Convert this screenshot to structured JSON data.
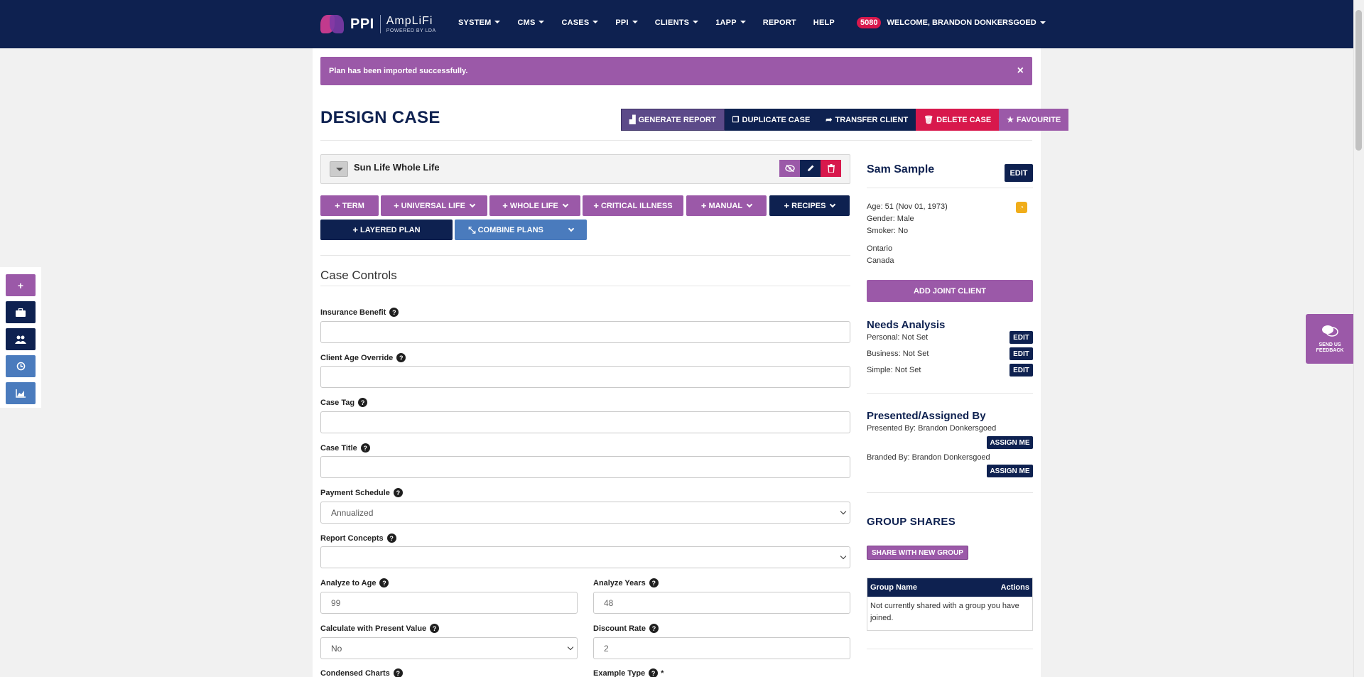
{
  "brand": {
    "ppi": "PPI",
    "amplifi": "AmpLiFi",
    "powered": "POWERED BY LDA"
  },
  "nav": {
    "items": [
      {
        "label": "SYSTEM",
        "dropdown": true
      },
      {
        "label": "CMS",
        "dropdown": true
      },
      {
        "label": "CASES",
        "dropdown": true
      },
      {
        "label": "PPI",
        "dropdown": true
      },
      {
        "label": "CLIENTS",
        "dropdown": true
      },
      {
        "label": "1APP",
        "dropdown": true
      },
      {
        "label": "REPORT",
        "dropdown": false
      },
      {
        "label": "HELP",
        "dropdown": false
      }
    ],
    "notification_count": "5080",
    "welcome": "WELCOME, BRANDON DONKERSGOED"
  },
  "alert": {
    "message": "Plan has been imported successfully.",
    "close": "×"
  },
  "page": {
    "title": "DESIGN CASE",
    "actions": {
      "generate": "GENERATE REPORT",
      "duplicate": "DUPLICATE CASE",
      "transfer": "TRANSFER CLIENT",
      "delete": "DELETE CASE",
      "favourite": "FAVOURITE"
    }
  },
  "plan": {
    "name": "Sun Life Whole Life"
  },
  "add_plan": {
    "term": "TERM",
    "universal_life": "UNIVERSAL LIFE",
    "whole_life": "WHOLE LIFE",
    "critical_illness": "CRITICAL ILLNESS",
    "manual": "MANUAL",
    "recipes": "RECIPES",
    "layered": "LAYERED PLAN",
    "combine": "COMBINE PLANS"
  },
  "case_controls": {
    "title": "Case Controls",
    "insurance_benefit": {
      "label": "Insurance Benefit",
      "value": ""
    },
    "client_age_override": {
      "label": "Client Age Override",
      "value": ""
    },
    "case_tag": {
      "label": "Case Tag",
      "value": ""
    },
    "case_title": {
      "label": "Case Title",
      "value": ""
    },
    "payment_schedule": {
      "label": "Payment Schedule",
      "value": "Annualized"
    },
    "report_concepts": {
      "label": "Report Concepts",
      "value": ""
    },
    "analyze_to_age": {
      "label": "Analyze to Age",
      "value": "99"
    },
    "analyze_years": {
      "label": "Analyze Years",
      "value": "48"
    },
    "present_value": {
      "label": "Calculate with Present Value",
      "value": "No"
    },
    "discount_rate": {
      "label": "Discount Rate",
      "value": "2"
    },
    "condensed_charts": {
      "label": "Condensed Charts"
    },
    "example_type": {
      "label": "Example Type",
      "required": "*"
    }
  },
  "client": {
    "name": "Sam Sample",
    "edit": "EDIT",
    "age": "Age: 51 (Nov 01, 1973)",
    "gender": "Gender: Male",
    "smoker": "Smoker: No",
    "province": "Ontario",
    "country": "Canada",
    "add_joint": "ADD JOINT CLIENT"
  },
  "needs": {
    "title": "Needs Analysis",
    "personal": "Personal: Not Set",
    "business": "Business: Not Set",
    "simple": "Simple: Not Set",
    "edit": "EDIT"
  },
  "presented": {
    "title": "Presented/Assigned By",
    "presented_by": "Presented By: Brandon Donkersgoed",
    "branded_by": "Branded By: Brandon Donkersgoed",
    "assign": "ASSIGN ME"
  },
  "group_shares": {
    "title": "GROUP SHARES",
    "share_button": "SHARE WITH NEW GROUP",
    "col_name": "Group Name",
    "col_actions": "Actions",
    "empty": "Not currently shared with a group you have joined."
  },
  "feedback": {
    "label": "SEND US FEEDBACK"
  },
  "colors": {
    "navy": "#0e2150",
    "purple": "#9b59a8",
    "red": "#d8184c",
    "steel": "#4a7bbd"
  }
}
